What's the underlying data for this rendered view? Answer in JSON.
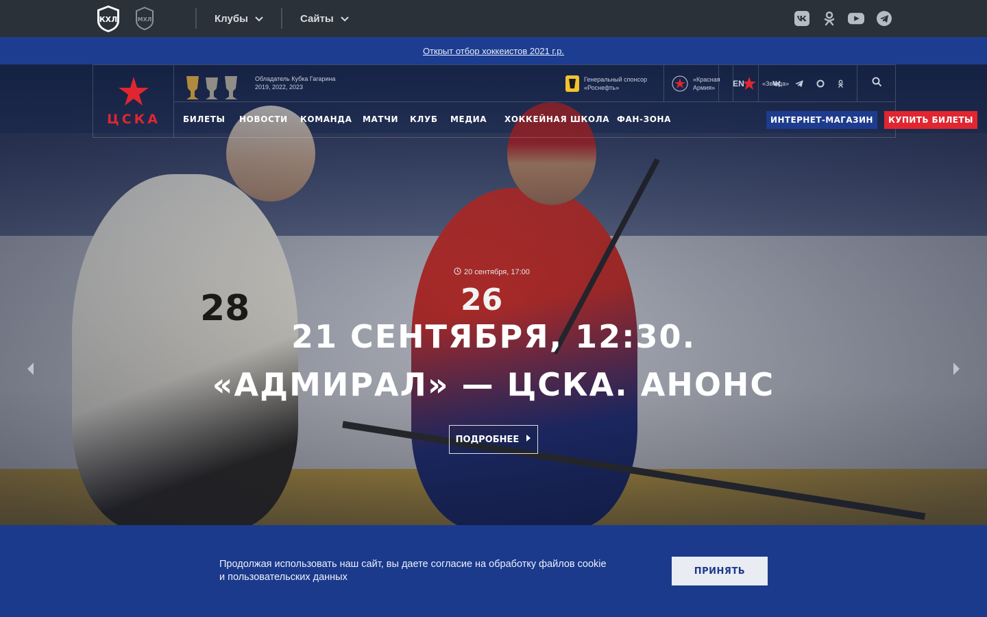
{
  "topbar": {
    "khl_logo": "КХЛ",
    "mhl_logo": "МХЛ",
    "clubs_label": "Клубы",
    "sites_label": "Сайты",
    "social_icons": [
      "vk-icon",
      "odnoklassniki-icon",
      "youtube-icon",
      "telegram-icon"
    ]
  },
  "announcement": {
    "link_text": "Открыт отбор хоккеистов 2021 г.р."
  },
  "header": {
    "logo_text": "ЦСКА",
    "cup_caption": "Обладатель Кубка Гагарина",
    "cup_years": "2019, 2022, 2023",
    "sponsor_line1": "Генеральный спонсор",
    "sponsor_line2": "«Роснефть»",
    "partner1_line1": "«Красная",
    "partner1_line2": "Армия»",
    "partner2": "«Звезда»",
    "lang": "EN",
    "header_social_icons": [
      "vk-icon",
      "telegram-icon",
      "rutube-icon",
      "odnoklassniki-icon"
    ]
  },
  "nav": {
    "items": [
      "БИЛЕТЫ",
      "НОВОСТИ",
      "КОМАНДА",
      "МАТЧИ",
      "КЛУБ",
      "МЕДИА",
      "ХОККЕЙНАЯ ШКОЛА",
      "ФАН-ЗОНА"
    ],
    "shop": "ИНТЕРНЕТ-МАГАЗИН",
    "buy_tickets": "КУПИТЬ БИЛЕТЫ"
  },
  "hero": {
    "date": "20 сентября, 17:00",
    "headline_line1": "21 СЕНТЯБРЯ, 12:30.",
    "headline_line2": "«АДМИРАЛ» — ЦСКА. АНОНС",
    "more_button": "ПОДРОБНЕЕ",
    "jersey_left": "28",
    "jersey_right": "26"
  },
  "cookie": {
    "text_line1": "Продолжая использовать наш сайт, вы даете согласие на обработку файлов cookie",
    "text_line2": "и пользовательских данных",
    "accept": "ПРИНЯТЬ"
  },
  "colors": {
    "topbar_bg": "#2a3138",
    "brand_blue": "#1b3a8c",
    "brand_red": "#e02630"
  }
}
